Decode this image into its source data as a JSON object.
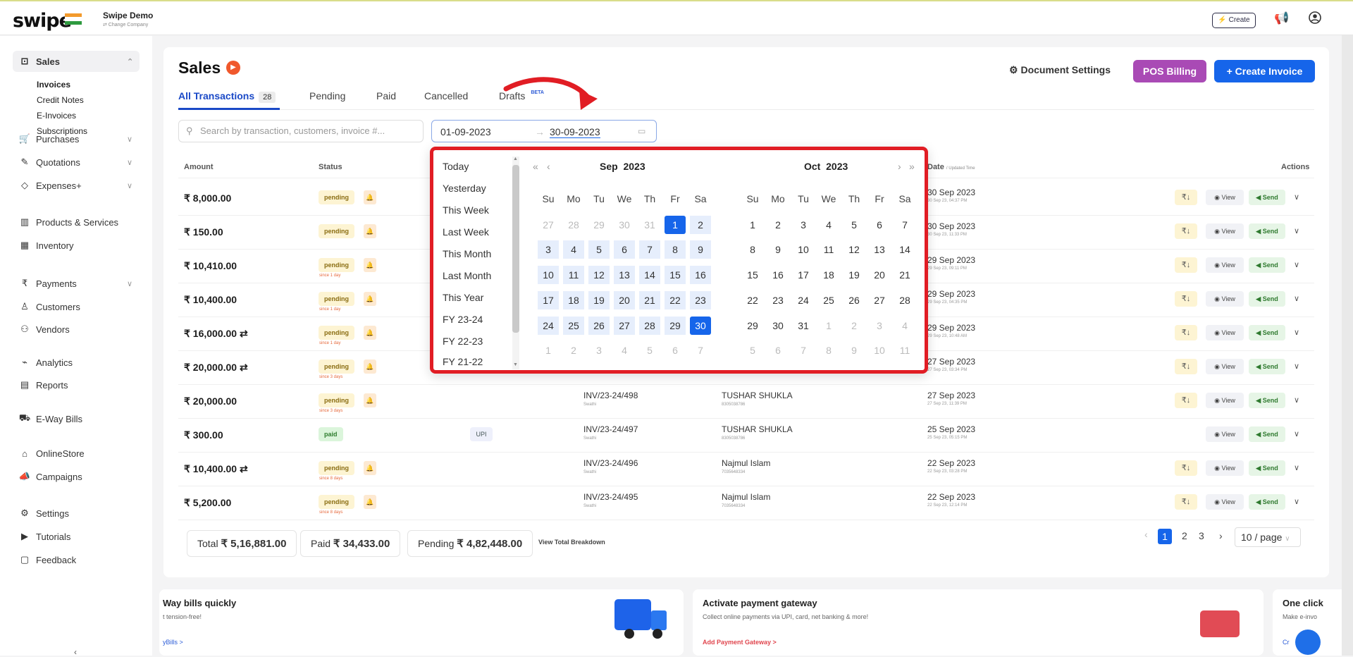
{
  "topbar": {
    "logo": "swipe",
    "company": "Swipe Demo",
    "change": "⇄ Change Company",
    "create": "⚡ Create"
  },
  "sidebar": {
    "sales": "Sales",
    "sales_sub": [
      "Invoices",
      "Credit Notes",
      "E-Invoices",
      "Subscriptions"
    ],
    "items": [
      {
        "label": "Purchases",
        "icon": "cart-icon",
        "chev": true
      },
      {
        "label": "Quotations",
        "icon": "pen-icon",
        "chev": true
      },
      {
        "label": "Expenses+",
        "icon": "tag-icon",
        "chev": true
      },
      {
        "label": "Products & Services",
        "icon": "barcode-icon",
        "chev": false
      },
      {
        "label": "Inventory",
        "icon": "inventory-icon",
        "chev": false
      },
      {
        "label": "Payments",
        "icon": "rupee-icon",
        "chev": true
      },
      {
        "label": "Customers",
        "icon": "user-icon",
        "chev": false
      },
      {
        "label": "Vendors",
        "icon": "users-icon",
        "chev": false
      },
      {
        "label": "Analytics",
        "icon": "chart-icon",
        "chev": false
      },
      {
        "label": "Reports",
        "icon": "report-icon",
        "chev": false
      },
      {
        "label": "E-Way Bills",
        "icon": "truck-icon",
        "chev": false
      },
      {
        "label": "OnlineStore",
        "icon": "store-icon",
        "chev": false
      },
      {
        "label": "Campaigns",
        "icon": "megaphone-icon",
        "chev": false
      },
      {
        "label": "Settings",
        "icon": "gear-icon",
        "chev": false
      },
      {
        "label": "Tutorials",
        "icon": "youtube-icon",
        "chev": false
      },
      {
        "label": "Feedback",
        "icon": "chat-icon",
        "chev": false
      }
    ]
  },
  "header": {
    "title": "Sales",
    "doc_settings": "Document Settings",
    "pos": "POS Billing",
    "create_invoice": "+ Create Invoice"
  },
  "tabs": {
    "all": "All Transactions",
    "all_count": "28",
    "pending": "Pending",
    "paid": "Paid",
    "cancelled": "Cancelled",
    "drafts": "Drafts",
    "beta": "BETA"
  },
  "search": {
    "placeholder": "Search by transaction, customers, invoice #..."
  },
  "range": {
    "start": "01-09-2023",
    "sep": "→",
    "end": "30-09-2023"
  },
  "table": {
    "headers": {
      "amount": "Amount",
      "status": "Status",
      "date": "Date",
      "date_small": "/ Updated Time",
      "actions": "Actions"
    },
    "actions": {
      "rupee": "₹↓",
      "view": "◉ View",
      "send": "◀ Send"
    },
    "rows": [
      {
        "amount": "₹ 8,000.00",
        "status": "pending",
        "since": "",
        "inv": "",
        "cust": "",
        "date": "30 Sep 2023",
        "time": "30 Sep 23, 04:37 PM",
        "upi": "",
        "rupee": true
      },
      {
        "amount": "₹ 150.00",
        "status": "pending",
        "since": "",
        "inv": "",
        "cust": "",
        "date": "30 Sep 2023",
        "time": "30 Sep 23, 11:33 PM",
        "upi": "",
        "rupee": true
      },
      {
        "amount": "₹ 10,410.00",
        "status": "pending",
        "since": "since 1 day",
        "inv": "",
        "cust": "",
        "date": "29 Sep 2023",
        "time": "29 Sep 23, 09:11 PM",
        "upi": "",
        "rupee": true
      },
      {
        "amount": "₹ 10,400.00",
        "status": "pending",
        "since": "since 1 day",
        "inv": "",
        "cust": "",
        "date": "29 Sep 2023",
        "time": "29 Sep 23, 04:35 PM",
        "upi": "",
        "rupee": true
      },
      {
        "amount": "₹ 16,000.00 ⇄",
        "status": "pending",
        "since": "since 1 day",
        "inv": "",
        "cust": "",
        "date": "29 Sep 2023",
        "time": "29 Sep 23, 10:48 AM",
        "upi": "",
        "rupee": true
      },
      {
        "amount": "₹ 20,000.00 ⇄",
        "status": "pending",
        "since": "since 3 days",
        "inv": "",
        "cust": "",
        "date": "27 Sep 2023",
        "time": "27 Sep 23, 03:34 PM",
        "upi": "",
        "rupee": true
      },
      {
        "amount": "₹ 20,000.00",
        "status": "pending",
        "since": "since 3 days",
        "inv": "INV/23-24/498",
        "inv_s": "Swathi",
        "cust": "TUSHAR SHUKLA",
        "cust_s": "8305038786",
        "date": "27 Sep 2023",
        "time": "27 Sep 23, 11:39 PM",
        "upi": "",
        "rupee": true
      },
      {
        "amount": "₹ 300.00",
        "status": "paid",
        "since": "",
        "inv": "INV/23-24/497",
        "inv_s": "Swathi",
        "cust": "TUSHAR SHUKLA",
        "cust_s": "8305038786",
        "date": "25 Sep 2023",
        "time": "25 Sep 23, 05:15 PM",
        "upi": "UPI",
        "rupee": false
      },
      {
        "amount": "₹ 10,400.00 ⇄",
        "status": "pending",
        "since": "since 8 days",
        "inv": "INV/23-24/496",
        "inv_s": "Swathi",
        "cust": "Najmul Islam",
        "cust_s": "7035648334",
        "date": "22 Sep 2023",
        "time": "22 Sep 23, 03:28 PM",
        "upi": "",
        "rupee": true
      },
      {
        "amount": "₹ 5,200.00",
        "status": "pending",
        "since": "since 8 days",
        "inv": "INV/23-24/495",
        "inv_s": "Swathi",
        "cust": "Najmul Islam",
        "cust_s": "7035648334",
        "date": "22 Sep 2023",
        "time": "22 Sep 23, 12:14 PM",
        "upi": "",
        "rupee": true
      }
    ]
  },
  "totals": {
    "total_label": "Total",
    "total": "₹ 5,16,881.00",
    "paid_label": "Paid",
    "paid": "₹ 34,433.00",
    "pending_label": "Pending",
    "pending": "₹ 4,82,448.00",
    "breakdown": "View Total Breakdown"
  },
  "pagination": {
    "pages": [
      "1",
      "2",
      "3"
    ],
    "per_page": "10 / page"
  },
  "datepicker": {
    "presets": [
      "Today",
      "Yesterday",
      "This Week",
      "Last Week",
      "This Month",
      "Last Month",
      "This Year",
      "FY 23-24",
      "FY 22-23",
      "FY 21-22"
    ],
    "weekdays": [
      "Su",
      "Mo",
      "Tu",
      "We",
      "Th",
      "Fr",
      "Sa"
    ],
    "left": {
      "month": "Sep",
      "year": "2023",
      "days": [
        [
          "27",
          "28",
          "29",
          "30",
          "31",
          "1",
          "2"
        ],
        [
          "3",
          "4",
          "5",
          "6",
          "7",
          "8",
          "9"
        ],
        [
          "10",
          "11",
          "12",
          "13",
          "14",
          "15",
          "16"
        ],
        [
          "17",
          "18",
          "19",
          "20",
          "21",
          "22",
          "23"
        ],
        [
          "24",
          "25",
          "26",
          "27",
          "28",
          "29",
          "30"
        ],
        [
          "1",
          "2",
          "3",
          "4",
          "5",
          "6",
          "7"
        ]
      ]
    },
    "right": {
      "month": "Oct",
      "year": "2023",
      "days": [
        [
          "1",
          "2",
          "3",
          "4",
          "5",
          "6",
          "7"
        ],
        [
          "8",
          "9",
          "10",
          "11",
          "12",
          "13",
          "14"
        ],
        [
          "15",
          "16",
          "17",
          "18",
          "19",
          "20",
          "21"
        ],
        [
          "22",
          "23",
          "24",
          "25",
          "26",
          "27",
          "28"
        ],
        [
          "29",
          "30",
          "31",
          "1",
          "2",
          "3",
          "4"
        ],
        [
          "5",
          "6",
          "7",
          "8",
          "9",
          "10",
          "11"
        ]
      ]
    }
  },
  "promos": [
    {
      "title": "Way bills quickly",
      "desc": "t tension-free!",
      "link": "yBills >"
    },
    {
      "title": "Activate payment gateway",
      "desc": "Collect online payments via UPI, card, net banking & more!",
      "link": "Add Payment Gateway >"
    },
    {
      "title": "One click",
      "desc": "Make e-invo",
      "link": "Cr"
    }
  ],
  "colors": {
    "primary": "#1665ea",
    "pos": "#a94ab5",
    "highlight": "#e11d24"
  }
}
